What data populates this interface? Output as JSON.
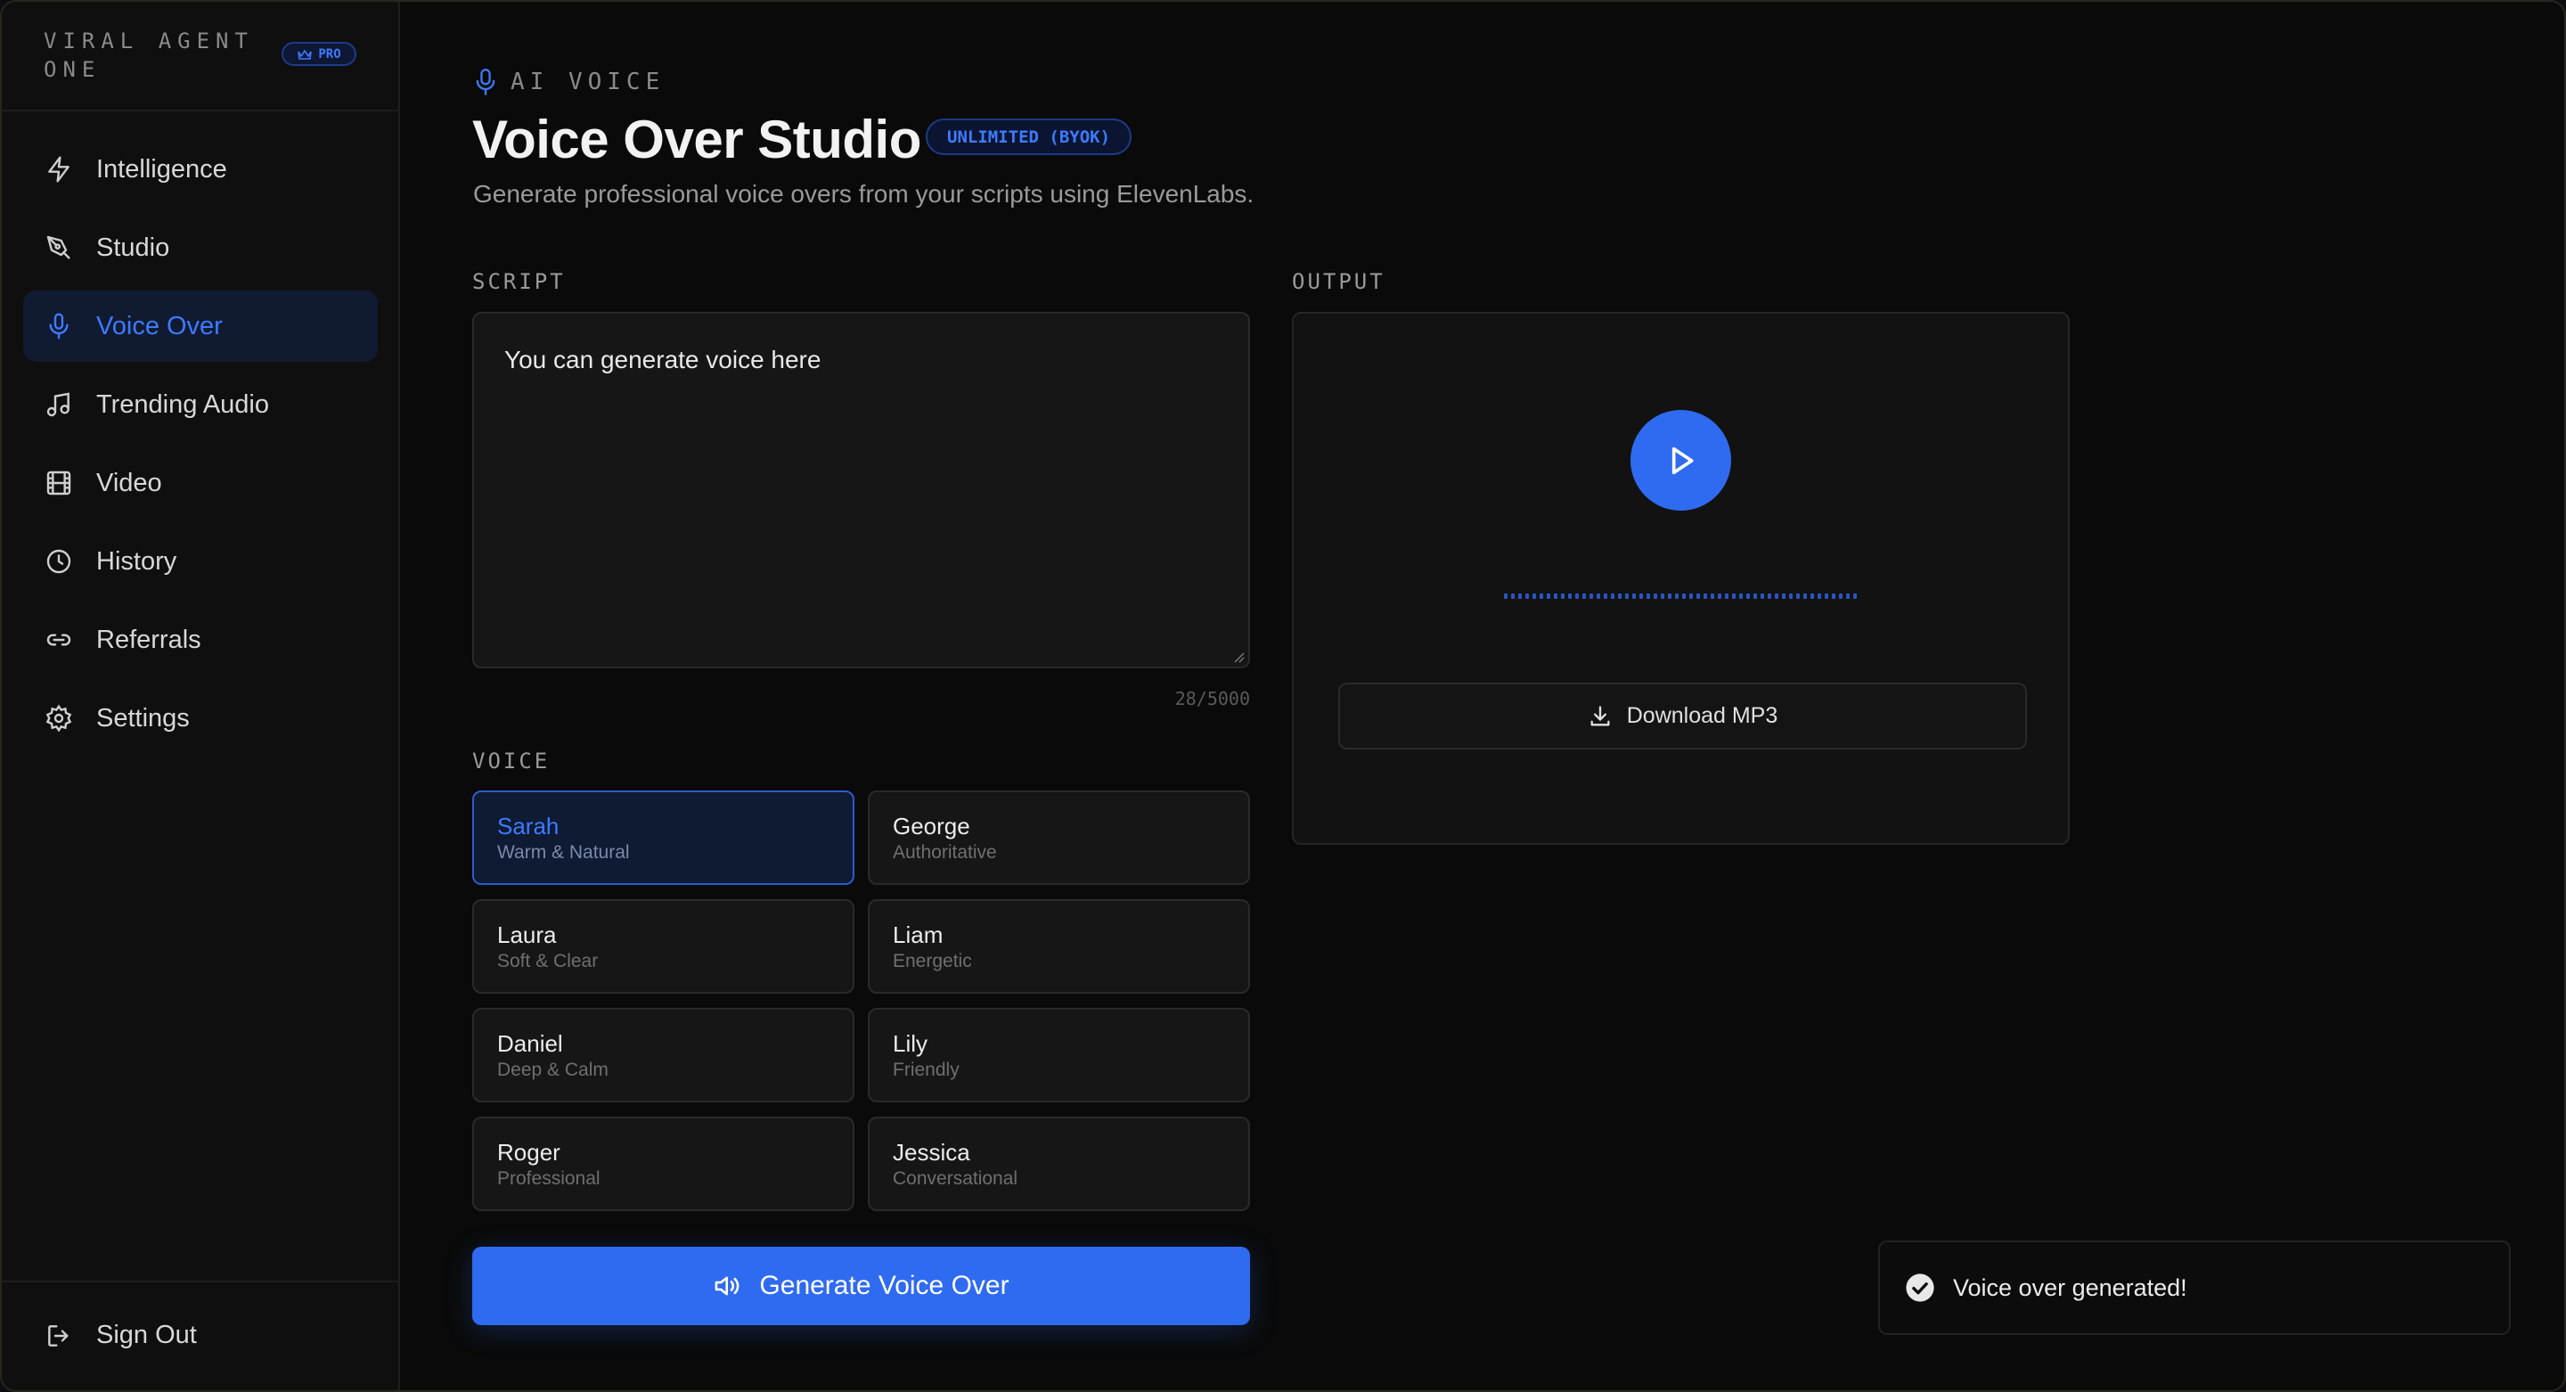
{
  "sidebar": {
    "brand": "VIRAL AGENT ONE",
    "badge": "PRO",
    "items": [
      {
        "label": "Intelligence",
        "icon": "bolt-icon"
      },
      {
        "label": "Studio",
        "icon": "pen-tool-icon"
      },
      {
        "label": "Voice Over",
        "icon": "microphone-icon",
        "active": true
      },
      {
        "label": "Trending Audio",
        "icon": "music-note-icon"
      },
      {
        "label": "Video",
        "icon": "film-icon"
      },
      {
        "label": "History",
        "icon": "clock-icon"
      },
      {
        "label": "Referrals",
        "icon": "link-icon"
      },
      {
        "label": "Settings",
        "icon": "gear-icon"
      }
    ],
    "sign_out": "Sign Out"
  },
  "header": {
    "eyebrow": "AI VOICE",
    "title": "Voice Over Studio",
    "badge": "UNLIMITED (BYOK)",
    "subtitle": "Generate professional voice overs from your scripts using ElevenLabs."
  },
  "script": {
    "label": "SCRIPT",
    "value": "You can generate voice here",
    "char_count": "28/5000"
  },
  "voice": {
    "label": "VOICE",
    "options": [
      {
        "name": "Sarah",
        "desc": "Warm & Natural",
        "selected": true
      },
      {
        "name": "George",
        "desc": "Authoritative"
      },
      {
        "name": "Laura",
        "desc": "Soft & Clear"
      },
      {
        "name": "Liam",
        "desc": "Energetic"
      },
      {
        "name": "Daniel",
        "desc": "Deep & Calm"
      },
      {
        "name": "Lily",
        "desc": "Friendly"
      },
      {
        "name": "Roger",
        "desc": "Professional"
      },
      {
        "name": "Jessica",
        "desc": "Conversational"
      }
    ]
  },
  "generate_button": "Generate Voice Over",
  "output": {
    "label": "OUTPUT",
    "download_label": "Download MP3"
  },
  "toast": {
    "message": "Voice over generated!"
  },
  "colors": {
    "accent": "#2f6bf0",
    "background": "#0a0a0a",
    "selected_bg": "#0f1a33"
  }
}
